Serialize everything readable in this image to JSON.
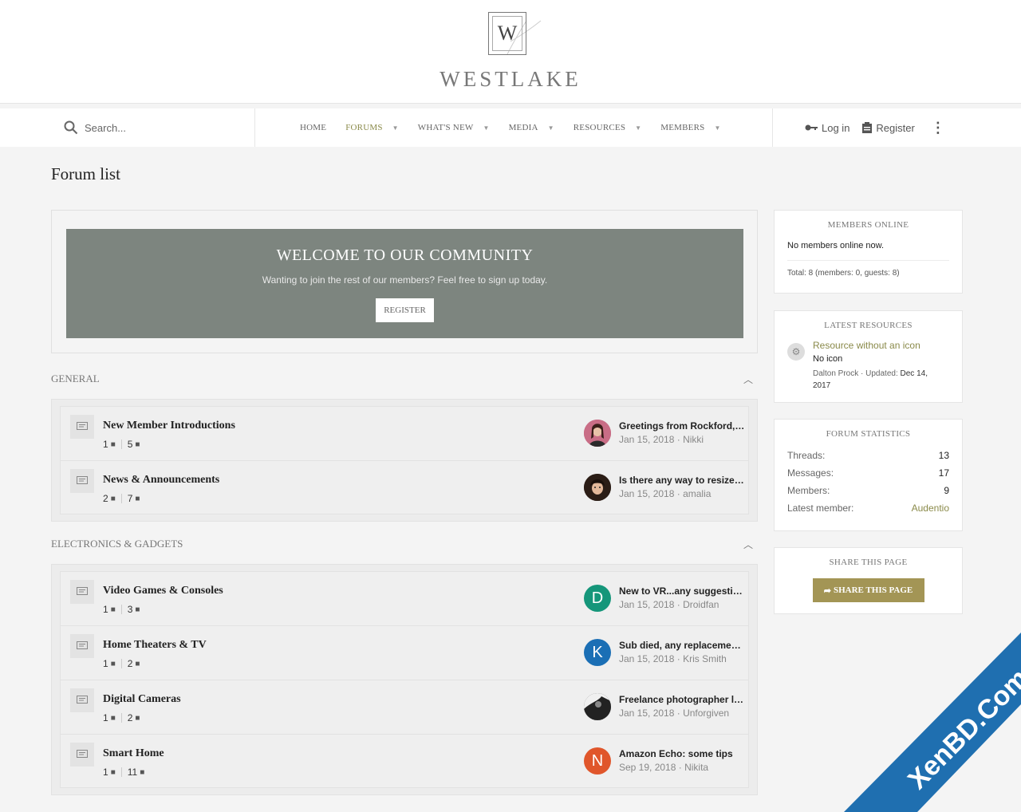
{
  "brand": {
    "logo_letter": "W",
    "name": "WESTLAKE"
  },
  "search": {
    "placeholder": "Search..."
  },
  "nav": {
    "items": [
      {
        "label": "HOME",
        "has_caret": false
      },
      {
        "label": "FORUMS",
        "has_caret": true,
        "active": true
      },
      {
        "label": "WHAT'S NEW",
        "has_caret": true
      },
      {
        "label": "MEDIA",
        "has_caret": true
      },
      {
        "label": "RESOURCES",
        "has_caret": true
      },
      {
        "label": "MEMBERS",
        "has_caret": true
      }
    ],
    "login": "Log in",
    "register": "Register"
  },
  "page": {
    "title": "Forum list"
  },
  "welcome": {
    "title": "WELCOME TO OUR COMMUNITY",
    "text": "Wanting to join the rest of our members? Feel free to sign up today.",
    "button": "REGISTER"
  },
  "categories": [
    {
      "title": "GENERAL",
      "nodes": [
        {
          "title": "New Member Introductions",
          "threads": "1",
          "messages": "5",
          "last_title": "Greetings from Rockford, IL",
          "last_date": "Jan 15, 2018",
          "last_user": "Nikki",
          "avatar_letter": "",
          "avatar_color": "#b04a6a"
        },
        {
          "title": "News & Announcements",
          "threads": "2",
          "messages": "7",
          "last_title": "Is there any way to resize i...",
          "last_date": "Jan 15, 2018",
          "last_user": "amalia",
          "avatar_letter": "",
          "avatar_color": "#3a2a22"
        }
      ]
    },
    {
      "title": "ELECTRONICS & GADGETS",
      "nodes": [
        {
          "title": "Video Games & Consoles",
          "threads": "1",
          "messages": "3",
          "last_title": "New to VR...any suggestion...",
          "last_date": "Jan 15, 2018",
          "last_user": "Droidfan",
          "avatar_letter": "D",
          "avatar_color": "#15967a"
        },
        {
          "title": "Home Theaters & TV",
          "threads": "1",
          "messages": "2",
          "last_title": "Sub died, any replacement...",
          "last_date": "Jan 15, 2018",
          "last_user": "Kris Smith",
          "avatar_letter": "K",
          "avatar_color": "#1b6fb5"
        },
        {
          "title": "Digital Cameras",
          "threads": "1",
          "messages": "2",
          "last_title": "Freelance photographer lo...",
          "last_date": "Jan 15, 2018",
          "last_user": "Unforgiven",
          "avatar_letter": "",
          "avatar_color": "#2a2a2a"
        },
        {
          "title": "Smart Home",
          "threads": "1",
          "messages": "11",
          "last_title": "Amazon Echo: some tips",
          "last_date": "Sep 19, 2018",
          "last_user": "Nikita",
          "avatar_letter": "N",
          "avatar_color": "#e0562b"
        }
      ]
    }
  ],
  "sidebar": {
    "members_online": {
      "title": "MEMBERS ONLINE",
      "text": "No members online now.",
      "total": "Total: 8 (members: 0, guests: 8)"
    },
    "latest_resources": {
      "title": "LATEST RESOURCES",
      "item_title": "Resource without an icon",
      "item_sub": "No icon",
      "item_author": "Dalton Prock",
      "item_updated_label": "Updated:",
      "item_updated": "Dec 14, 2017"
    },
    "forum_stats": {
      "title": "FORUM STATISTICS",
      "rows": [
        {
          "label": "Threads:",
          "value": "13"
        },
        {
          "label": "Messages:",
          "value": "17"
        },
        {
          "label": "Members:",
          "value": "9"
        },
        {
          "label": "Latest member:",
          "value": "Audentio"
        }
      ]
    },
    "share": {
      "title": "SHARE THIS PAGE",
      "button": "SHARE THIS PAGE"
    }
  },
  "watermark": {
    "text": "XenBD.Com"
  },
  "colors": {
    "accent": "#8a8a4a",
    "welcome_bg": "#7d857f",
    "share_btn": "#a39555",
    "watermark": "#1f6fb0"
  }
}
